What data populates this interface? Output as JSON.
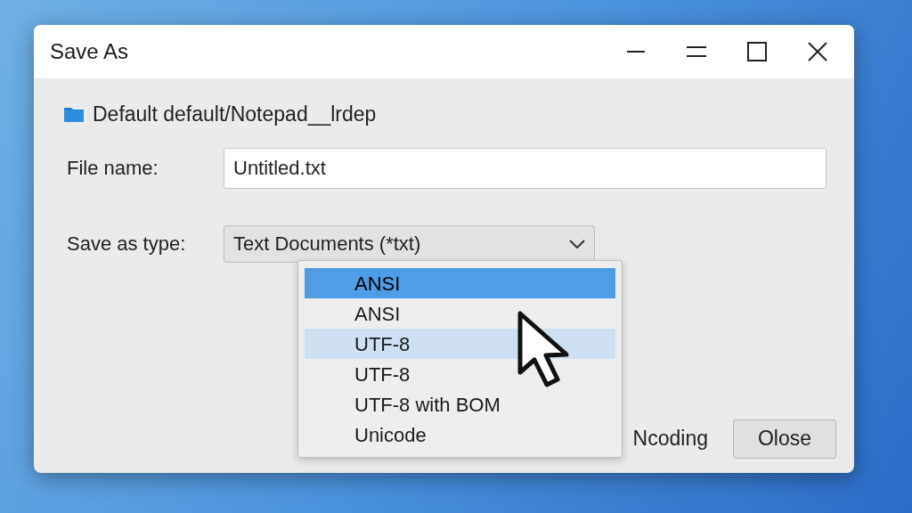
{
  "window": {
    "title": "Save As"
  },
  "path": "Default default/Notepad__lrdep",
  "file_name": {
    "label": "File name:",
    "value": "Untitled.txt"
  },
  "save_as_type": {
    "label": "Save as type:",
    "value": "Text Documents (*txt)"
  },
  "encoding_options": [
    {
      "label": "ANSI",
      "selected": true,
      "hovered": false
    },
    {
      "label": "ANSI",
      "selected": false,
      "hovered": false
    },
    {
      "label": "UTF-8",
      "selected": false,
      "hovered": true
    },
    {
      "label": "UTF-8",
      "selected": false,
      "hovered": false
    },
    {
      "label": "UTF-8 with BOM",
      "selected": false,
      "hovered": false
    },
    {
      "label": "Unicode",
      "selected": false,
      "hovered": false
    }
  ],
  "encoding_label": "Ncoding",
  "buttons": [
    "Olose"
  ]
}
